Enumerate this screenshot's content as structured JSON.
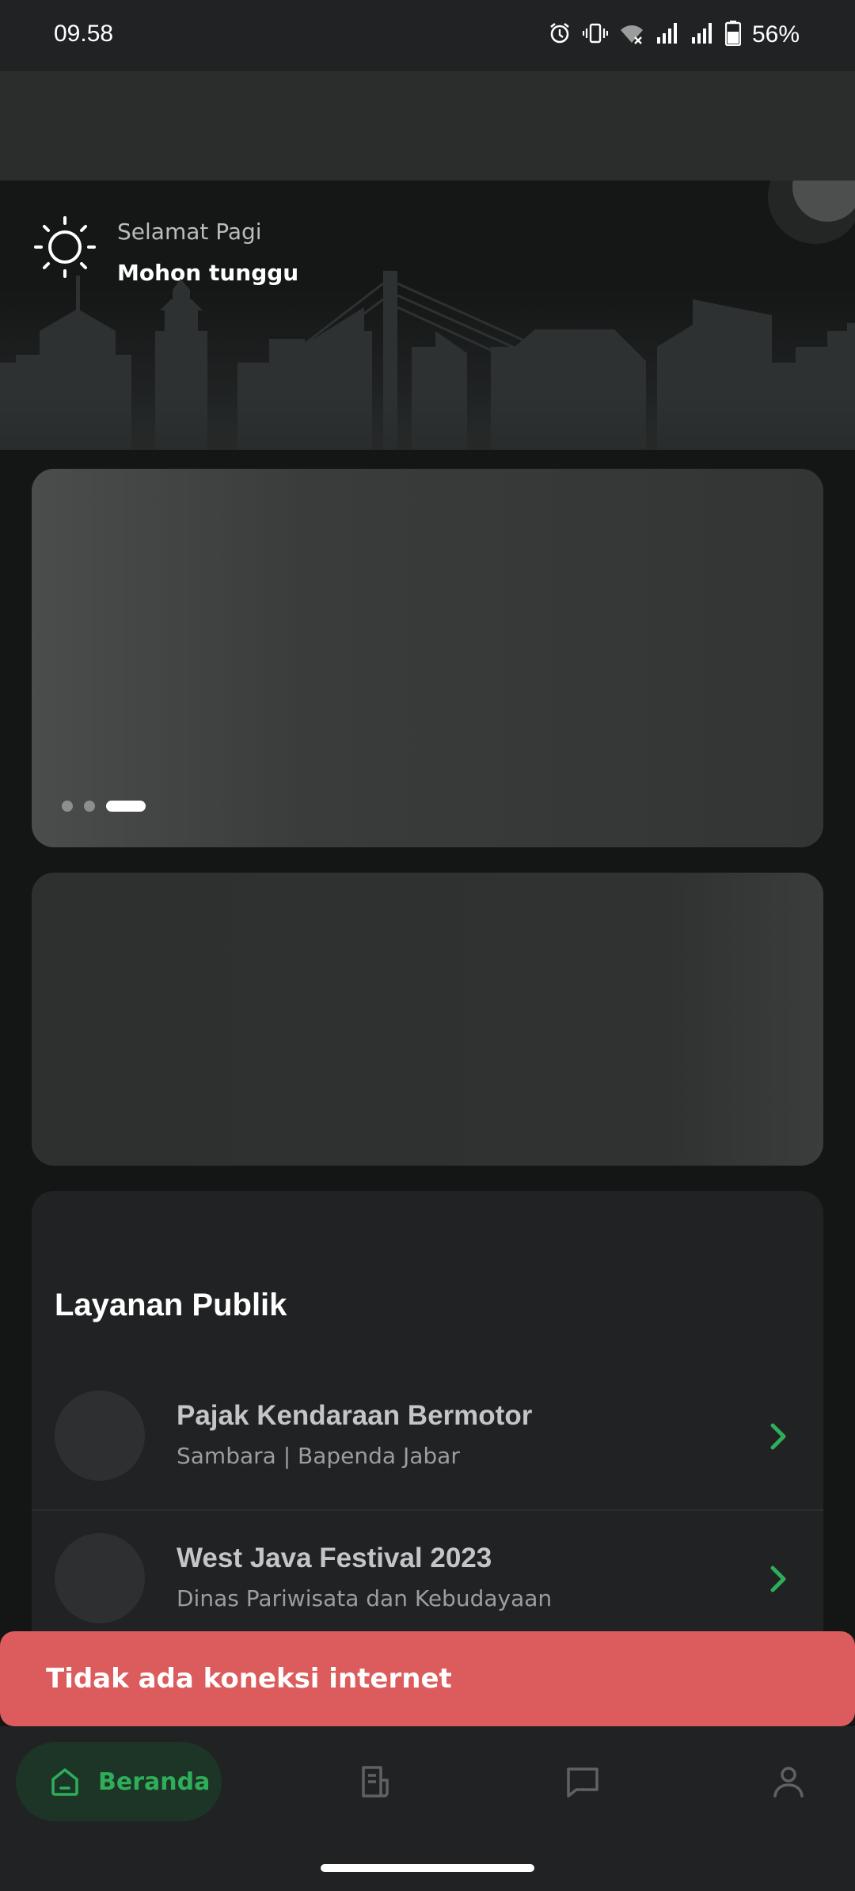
{
  "status_bar": {
    "time": "09.58",
    "battery": "56%",
    "icons": [
      "alarm-icon",
      "vibrate-icon",
      "wifi-off-icon",
      "signal-icon",
      "signal-icon",
      "battery-icon"
    ]
  },
  "greeting": {
    "subtitle": "Selamat Pagi",
    "title": "Mohon tunggu",
    "icon": "sun-icon"
  },
  "banner": {
    "page_count": 3,
    "active_page": 3
  },
  "services": {
    "title": "Layanan Publik",
    "items": [
      {
        "title": "Pajak Kendaraan Bermotor",
        "subtitle": "Sambara | Bapenda Jabar"
      },
      {
        "title": "West Java Festival 2023",
        "subtitle": "Dinas Pariwisata dan Kebudayaan"
      }
    ]
  },
  "snackbar": {
    "message": "Tidak ada koneksi internet",
    "color": "#dc5c5e"
  },
  "bottom_nav": {
    "items": [
      {
        "label": "Beranda",
        "icon": "home-icon",
        "active": true
      },
      {
        "label": "",
        "icon": "document-icon",
        "active": false
      },
      {
        "label": "",
        "icon": "chat-icon",
        "active": false
      },
      {
        "label": "",
        "icon": "profile-icon",
        "active": false
      }
    ],
    "accent_color": "#2fae5a"
  }
}
